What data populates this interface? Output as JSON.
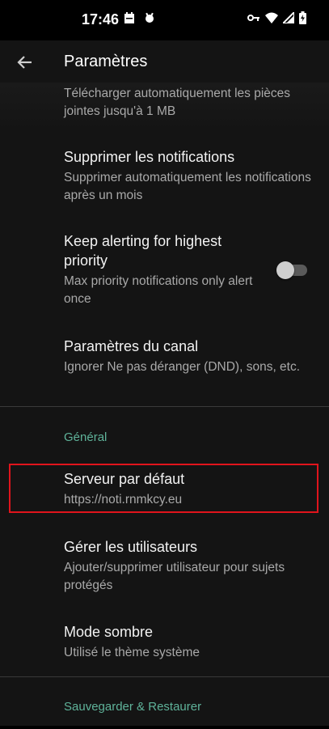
{
  "status": {
    "time": "17:46",
    "left_icons": [
      "calendar-icon",
      "bug-icon"
    ],
    "right_icons": [
      "key-icon",
      "wifi-icon",
      "signal-icon",
      "battery-icon"
    ]
  },
  "appbar": {
    "back_icon": "arrow-left-icon",
    "title": "Paramètres"
  },
  "prefs": {
    "attachments_summary": "Télécharger automatiquement les pièces jointes jusqu'à 1 MB",
    "delete_notifications": {
      "title": "Supprimer les notifications",
      "summary": "Supprimer automatiquement les notifications après un mois"
    },
    "keep_alerting": {
      "title_line1": "Keep alerting for highest",
      "title_line2": "priority",
      "summary": "Max priority notifications only alert once",
      "enabled": false
    },
    "channel": {
      "title": "Paramètres du canal",
      "summary": "Ignorer Ne pas déranger (DND), sons, etc."
    }
  },
  "section_general": "Général",
  "general": {
    "default_server": {
      "title": "Serveur par défaut",
      "summary": "https://noti.rnmkcy.eu"
    },
    "manage_users": {
      "title": "Gérer les utilisateurs",
      "summary": "Ajouter/supprimer utilisateur pour sujets protégés"
    },
    "dark_mode": {
      "title": "Mode sombre",
      "summary": "Utilisé le thème système"
    }
  },
  "section_backup": "Sauvegarder & Restaurer",
  "colors": {
    "accent": "#5fb39a",
    "highlight": "#e0141c",
    "background": "#141414"
  }
}
